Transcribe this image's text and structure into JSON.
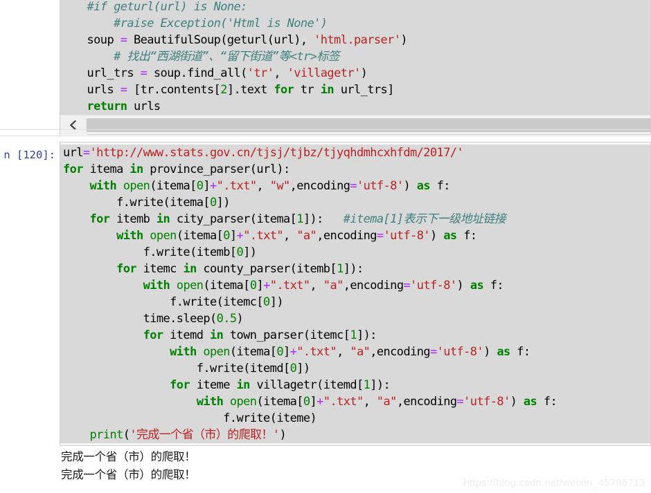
{
  "app": {
    "kind": "jupyter-notebook",
    "watermark": "https://blog.csdn.net/weixin_45786713"
  },
  "cell_one": {
    "prompt": "",
    "scrollbar": {
      "left_arrow_icon": "chevron-left-icon"
    },
    "lines": [
      [
        {
          "t": "com",
          "s": "    #if geturl(url) is None:"
        }
      ],
      [
        {
          "t": "com",
          "s": "        #raise Exception('Html is None')"
        }
      ],
      [
        {
          "t": "name",
          "s": "    soup "
        },
        {
          "t": "op",
          "s": "="
        },
        {
          "t": "name",
          "s": " BeautifulSoup(geturl(url), "
        },
        {
          "t": "str",
          "s": "'html.parser'"
        },
        {
          "t": "name",
          "s": ")"
        }
      ],
      [
        {
          "t": "com",
          "s": "        # 找出“西湖街道”、“留下街道”等<tr>标签"
        }
      ],
      [
        {
          "t": "name",
          "s": "    url_trs "
        },
        {
          "t": "op",
          "s": "="
        },
        {
          "t": "name",
          "s": " soup.find_all("
        },
        {
          "t": "str",
          "s": "'tr'"
        },
        {
          "t": "name",
          "s": ", "
        },
        {
          "t": "str",
          "s": "'villagetr'"
        },
        {
          "t": "name",
          "s": ")"
        }
      ],
      [
        {
          "t": "name",
          "s": "    urls "
        },
        {
          "t": "op",
          "s": "="
        },
        {
          "t": "name",
          "s": " [tr.contents["
        },
        {
          "t": "num",
          "s": "2"
        },
        {
          "t": "name",
          "s": "].text "
        },
        {
          "t": "kw",
          "s": "for"
        },
        {
          "t": "name",
          "s": " tr "
        },
        {
          "t": "kw",
          "s": "in"
        },
        {
          "t": "name",
          "s": " url_trs]"
        }
      ],
      [
        {
          "t": "kw",
          "s": "    return"
        },
        {
          "t": "name",
          "s": " urls"
        }
      ]
    ]
  },
  "cell_two": {
    "prompt": "n [120]:",
    "lines": [
      [
        {
          "t": "name",
          "s": "url"
        },
        {
          "t": "op",
          "s": "="
        },
        {
          "t": "str",
          "s": "'http://www.stats.gov.cn/tjsj/tjbz/tjyqhdmhcxhfdm/2017/'"
        }
      ],
      [
        {
          "t": "kw",
          "s": "for"
        },
        {
          "t": "name",
          "s": " itema "
        },
        {
          "t": "kw",
          "s": "in"
        },
        {
          "t": "name",
          "s": " province_parser(url):"
        }
      ],
      [
        {
          "t": "kw",
          "s": "    with"
        },
        {
          "t": "bi",
          "s": " open"
        },
        {
          "t": "name",
          "s": "(itema["
        },
        {
          "t": "num",
          "s": "0"
        },
        {
          "t": "name",
          "s": "]"
        },
        {
          "t": "op",
          "s": "+"
        },
        {
          "t": "str",
          "s": "\".txt\""
        },
        {
          "t": "name",
          "s": ", "
        },
        {
          "t": "str",
          "s": "\"w\""
        },
        {
          "t": "name",
          "s": ",encoding"
        },
        {
          "t": "op",
          "s": "="
        },
        {
          "t": "str",
          "s": "'utf-8'"
        },
        {
          "t": "name",
          "s": ") "
        },
        {
          "t": "kw",
          "s": "as"
        },
        {
          "t": "name",
          "s": " f:"
        }
      ],
      [
        {
          "t": "name",
          "s": "        f.write(itema["
        },
        {
          "t": "num",
          "s": "0"
        },
        {
          "t": "name",
          "s": "])"
        }
      ],
      [
        {
          "t": "kw",
          "s": "    for"
        },
        {
          "t": "name",
          "s": " itemb "
        },
        {
          "t": "kw",
          "s": "in"
        },
        {
          "t": "name",
          "s": " city_parser(itema["
        },
        {
          "t": "num",
          "s": "1"
        },
        {
          "t": "name",
          "s": "]):   "
        },
        {
          "t": "com",
          "s": "#itema[1]表示下一级地址链接"
        }
      ],
      [
        {
          "t": "kw",
          "s": "        with"
        },
        {
          "t": "bi",
          "s": " open"
        },
        {
          "t": "name",
          "s": "(itema["
        },
        {
          "t": "num",
          "s": "0"
        },
        {
          "t": "name",
          "s": "]"
        },
        {
          "t": "op",
          "s": "+"
        },
        {
          "t": "str",
          "s": "\".txt\""
        },
        {
          "t": "name",
          "s": ", "
        },
        {
          "t": "str",
          "s": "\"a\""
        },
        {
          "t": "name",
          "s": ",encoding"
        },
        {
          "t": "op",
          "s": "="
        },
        {
          "t": "str",
          "s": "'utf-8'"
        },
        {
          "t": "name",
          "s": ") "
        },
        {
          "t": "kw",
          "s": "as"
        },
        {
          "t": "name",
          "s": " f:"
        }
      ],
      [
        {
          "t": "name",
          "s": "            f.write(itemb["
        },
        {
          "t": "num",
          "s": "0"
        },
        {
          "t": "name",
          "s": "])"
        }
      ],
      [
        {
          "t": "kw",
          "s": "        for"
        },
        {
          "t": "name",
          "s": " itemc "
        },
        {
          "t": "kw",
          "s": "in"
        },
        {
          "t": "name",
          "s": " county_parser(itemb["
        },
        {
          "t": "num",
          "s": "1"
        },
        {
          "t": "name",
          "s": "]):"
        }
      ],
      [
        {
          "t": "kw",
          "s": "            with"
        },
        {
          "t": "bi",
          "s": " open"
        },
        {
          "t": "name",
          "s": "(itema["
        },
        {
          "t": "num",
          "s": "0"
        },
        {
          "t": "name",
          "s": "]"
        },
        {
          "t": "op",
          "s": "+"
        },
        {
          "t": "str",
          "s": "\".txt\""
        },
        {
          "t": "name",
          "s": ", "
        },
        {
          "t": "str",
          "s": "\"a\""
        },
        {
          "t": "name",
          "s": ",encoding"
        },
        {
          "t": "op",
          "s": "="
        },
        {
          "t": "str",
          "s": "'utf-8'"
        },
        {
          "t": "name",
          "s": ") "
        },
        {
          "t": "kw",
          "s": "as"
        },
        {
          "t": "name",
          "s": " f:"
        }
      ],
      [
        {
          "t": "name",
          "s": "                f.write(itemc["
        },
        {
          "t": "num",
          "s": "0"
        },
        {
          "t": "name",
          "s": "])"
        }
      ],
      [
        {
          "t": "name",
          "s": "            time.sleep("
        },
        {
          "t": "num",
          "s": "0.5"
        },
        {
          "t": "name",
          "s": ")"
        }
      ],
      [
        {
          "t": "kw",
          "s": "            for"
        },
        {
          "t": "name",
          "s": " itemd "
        },
        {
          "t": "kw",
          "s": "in"
        },
        {
          "t": "name",
          "s": " town_parser(itemc["
        },
        {
          "t": "num",
          "s": "1"
        },
        {
          "t": "name",
          "s": "]):"
        }
      ],
      [
        {
          "t": "kw",
          "s": "                with"
        },
        {
          "t": "bi",
          "s": " open"
        },
        {
          "t": "name",
          "s": "(itema["
        },
        {
          "t": "num",
          "s": "0"
        },
        {
          "t": "name",
          "s": "]"
        },
        {
          "t": "op",
          "s": "+"
        },
        {
          "t": "str",
          "s": "\".txt\""
        },
        {
          "t": "name",
          "s": ", "
        },
        {
          "t": "str",
          "s": "\"a\""
        },
        {
          "t": "name",
          "s": ",encoding"
        },
        {
          "t": "op",
          "s": "="
        },
        {
          "t": "str",
          "s": "'utf-8'"
        },
        {
          "t": "name",
          "s": ") "
        },
        {
          "t": "kw",
          "s": "as"
        },
        {
          "t": "name",
          "s": " f:"
        }
      ],
      [
        {
          "t": "name",
          "s": "                    f.write(itemd["
        },
        {
          "t": "num",
          "s": "0"
        },
        {
          "t": "name",
          "s": "])"
        }
      ],
      [
        {
          "t": "kw",
          "s": "                for"
        },
        {
          "t": "name",
          "s": " iteme "
        },
        {
          "t": "kw",
          "s": "in"
        },
        {
          "t": "name",
          "s": " villagetr(itemd["
        },
        {
          "t": "num",
          "s": "1"
        },
        {
          "t": "name",
          "s": "]):"
        }
      ],
      [
        {
          "t": "kw",
          "s": "                    with"
        },
        {
          "t": "bi",
          "s": " open"
        },
        {
          "t": "name",
          "s": "(itema["
        },
        {
          "t": "num",
          "s": "0"
        },
        {
          "t": "name",
          "s": "]"
        },
        {
          "t": "op",
          "s": "+"
        },
        {
          "t": "str",
          "s": "\".txt\""
        },
        {
          "t": "name",
          "s": ", "
        },
        {
          "t": "str",
          "s": "\"a\""
        },
        {
          "t": "name",
          "s": ",encoding"
        },
        {
          "t": "op",
          "s": "="
        },
        {
          "t": "str",
          "s": "'utf-8'"
        },
        {
          "t": "name",
          "s": ") "
        },
        {
          "t": "kw",
          "s": "as"
        },
        {
          "t": "name",
          "s": " f:"
        }
      ],
      [
        {
          "t": "name",
          "s": "                        f.write(iteme)"
        }
      ],
      [
        {
          "t": "bi",
          "s": "    print"
        },
        {
          "t": "name",
          "s": "("
        },
        {
          "t": "str",
          "s": "'完成一个省（市）的爬取！'"
        },
        {
          "t": "name",
          "s": ")"
        }
      ]
    ]
  },
  "output": {
    "lines": [
      "完成一个省（市）的爬取！",
      "完成一个省（市）的爬取！"
    ]
  },
  "colors": {
    "keyword": "#008000",
    "string": "#ba2121",
    "comment": "#408080",
    "operator": "#aa22ff",
    "number": "#008000",
    "prompt": "#303f9f",
    "code_background": "#d9d9d9",
    "cell_background": "#f7f7f7",
    "watermark": "#eeeeee"
  }
}
